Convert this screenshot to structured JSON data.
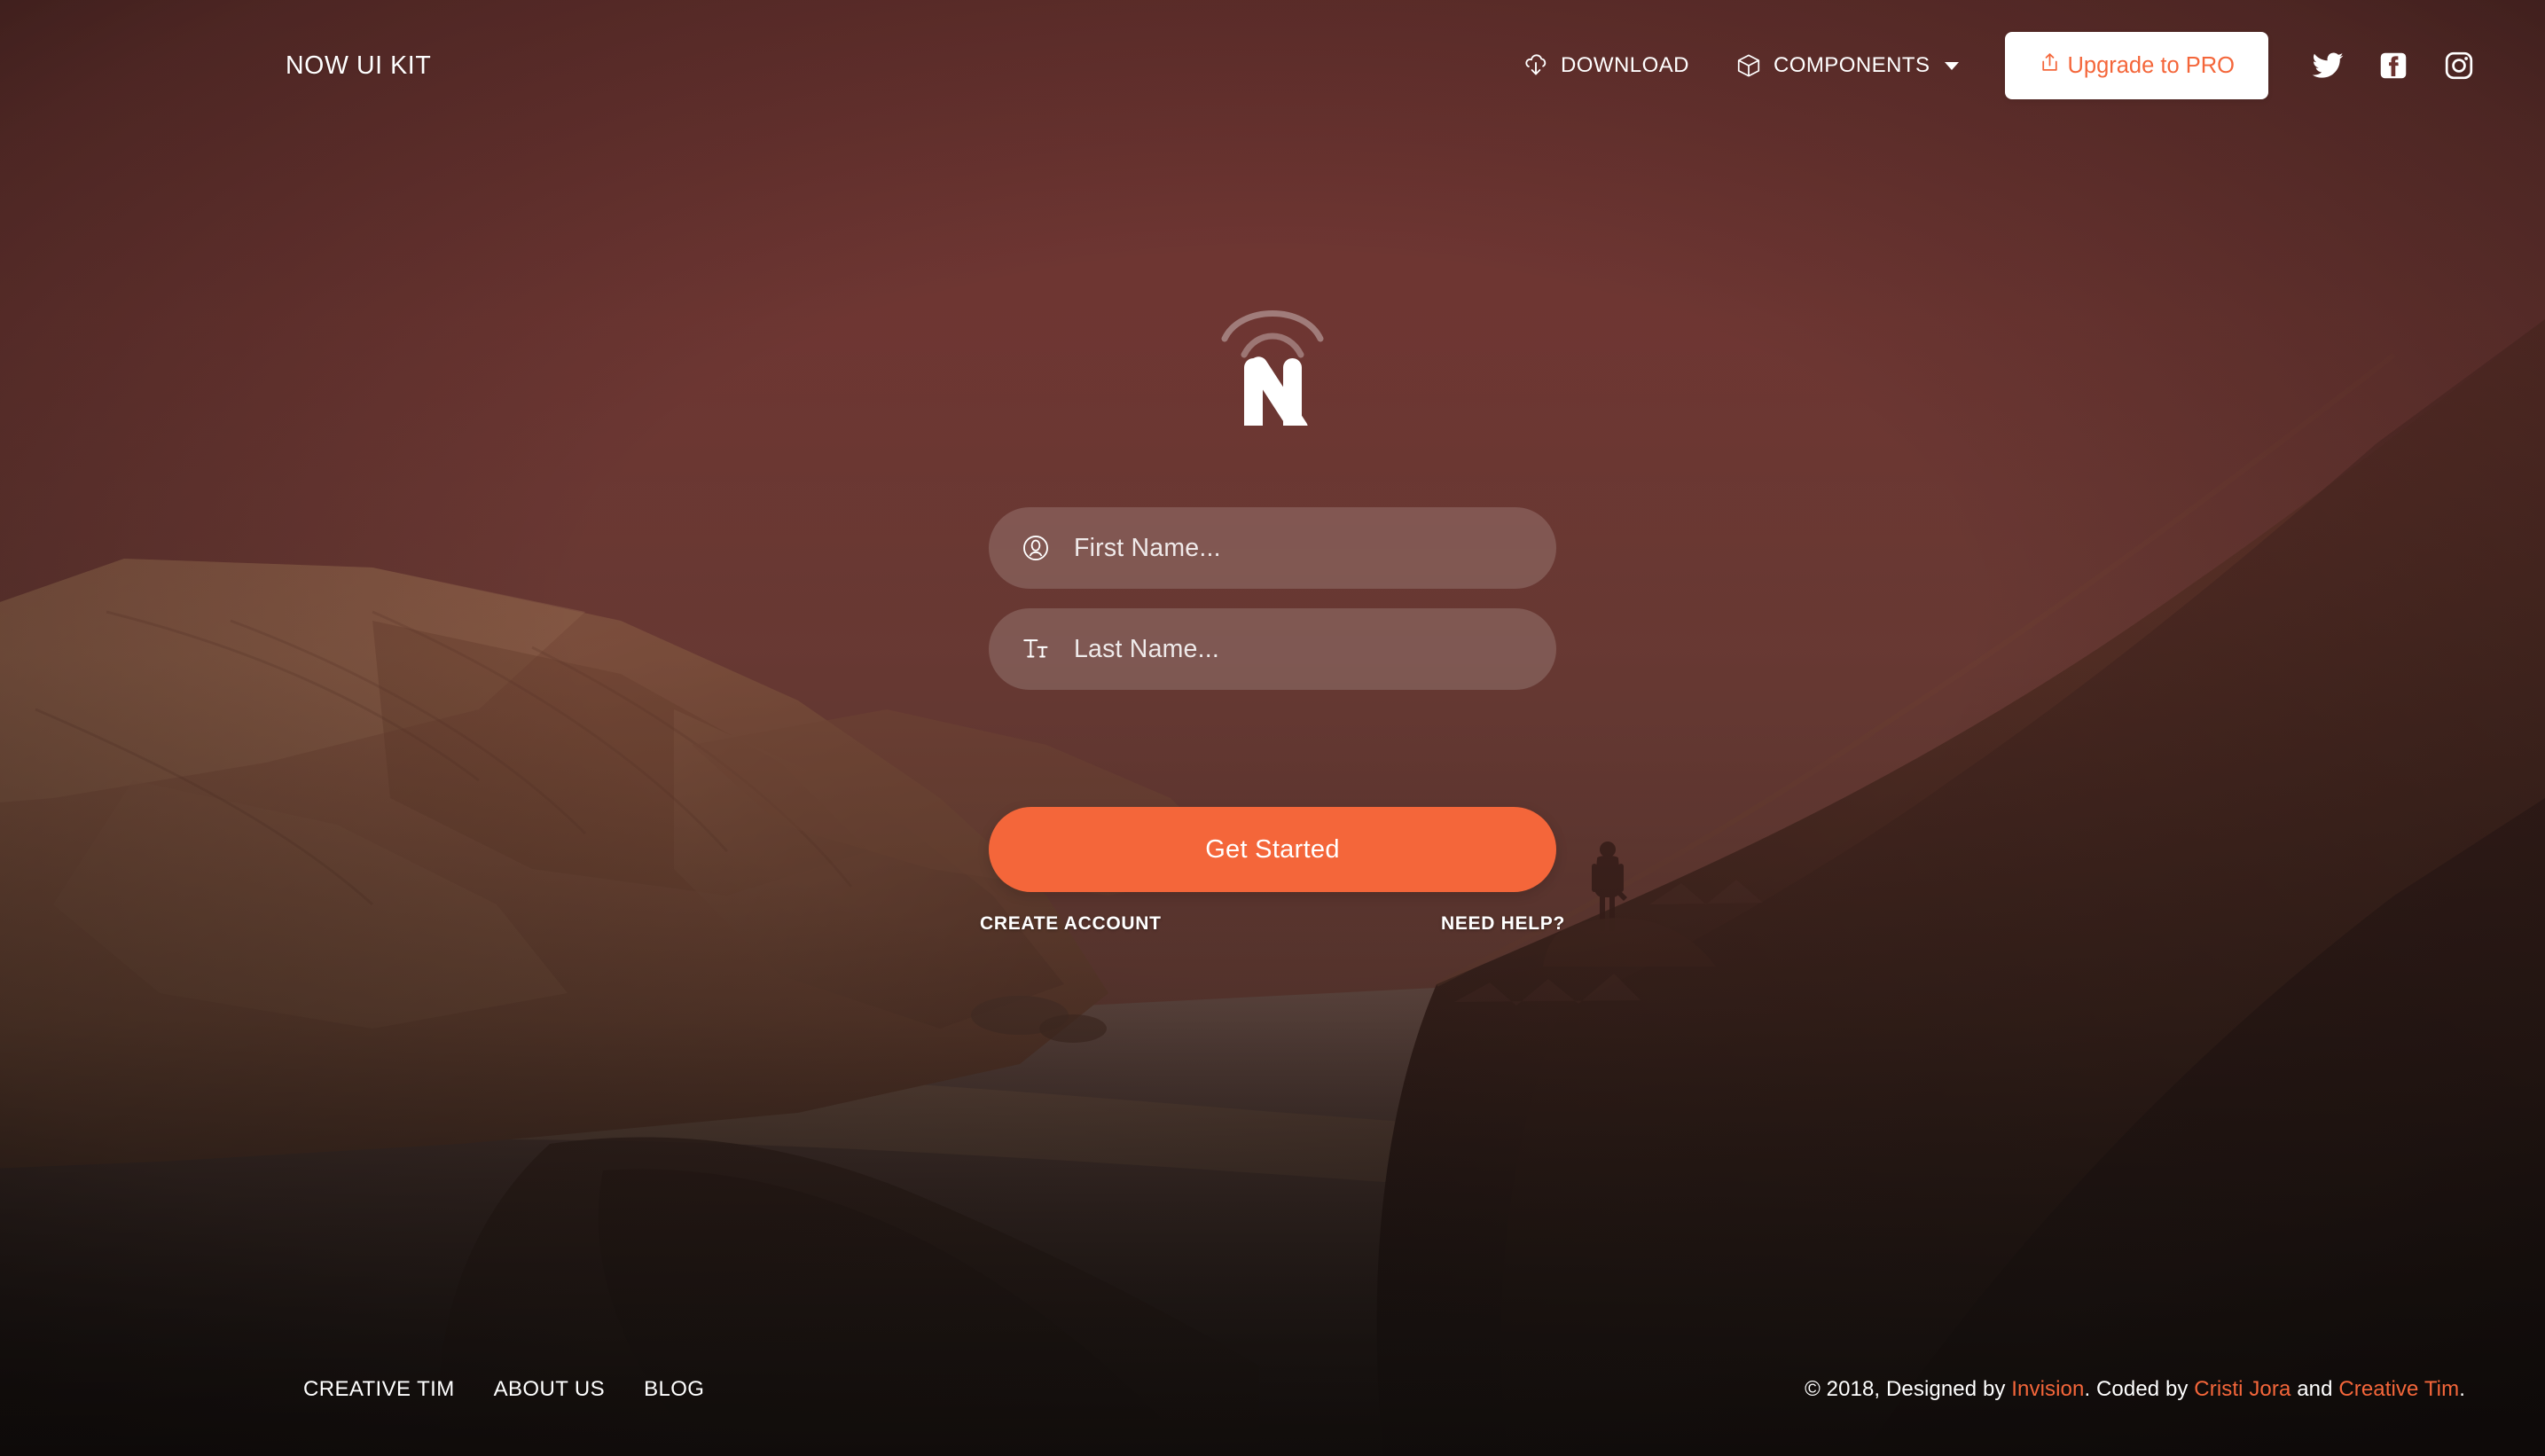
{
  "navbar": {
    "brand": "NOW UI KIT",
    "links": [
      {
        "label": "DOWNLOAD",
        "icon": "cloud-download-icon"
      },
      {
        "label": "COMPONENTS",
        "icon": "cube-icon",
        "has_caret": true
      }
    ],
    "pro_button": {
      "label": "Upgrade to PRO",
      "icon": "share-upload-icon"
    },
    "social": [
      {
        "name": "twitter-icon"
      },
      {
        "name": "facebook-icon"
      },
      {
        "name": "instagram-icon"
      }
    ]
  },
  "hero": {
    "logo_alt": "now-ui-kit-logo",
    "fields": [
      {
        "icon": "user-circle-icon",
        "placeholder": "First Name...",
        "value": ""
      },
      {
        "icon": "typography-icon",
        "placeholder": "Last Name...",
        "value": ""
      }
    ],
    "cta_label": "Get Started",
    "create_account_label": "CREATE ACCOUNT",
    "need_help_label": "NEED HELP?"
  },
  "footer": {
    "links": [
      "CREATIVE TIM",
      "ABOUT US",
      "BLOG"
    ],
    "copyright": {
      "prefix": "© 2018, Designed by ",
      "link1": "Invision",
      "middle": ". Coded by ",
      "link2": "Cristi Jora",
      "conjunction": " and ",
      "link3": "Creative Tim",
      "suffix": "."
    }
  },
  "colors": {
    "accent_orange": "#f4663a",
    "overlay_maroon": "#6c322f",
    "white": "#ffffff",
    "footer_dark": "#16110f"
  }
}
